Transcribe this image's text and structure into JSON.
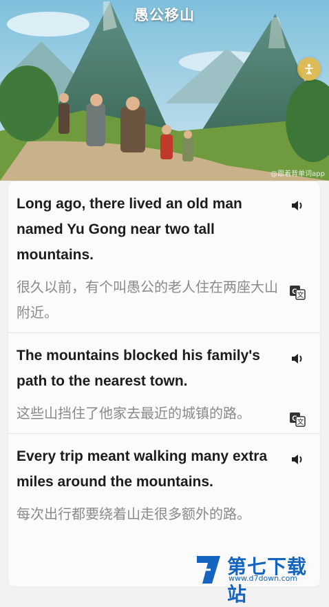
{
  "header": {
    "title": "愚公移山",
    "watermark": "@跟着背单词app"
  },
  "sentences": [
    {
      "en": "Long ago, there lived an old man named Yu Gong near two tall mountains.",
      "zh": "很久以前，有个叫愚公的老人住在两座大山附近。"
    },
    {
      "en": "The mountains blocked his family's path to the nearest town.",
      "zh": "这些山挡住了他家去最近的城镇的路。"
    },
    {
      "en": "Every trip meant walking many extra miles around the mountains.",
      "zh": "每次出行都要绕着山走很多额外的路。"
    }
  ],
  "icons": {
    "speaker": "speaker-icon",
    "translate": "translate-icon",
    "fab": "person-icon"
  },
  "site_logo": {
    "name": "第七下载站",
    "url": "www.d7down.com"
  },
  "colors": {
    "accent": "#e9b83e",
    "logo": "#1565c0",
    "sky": "#9fd0e6"
  }
}
